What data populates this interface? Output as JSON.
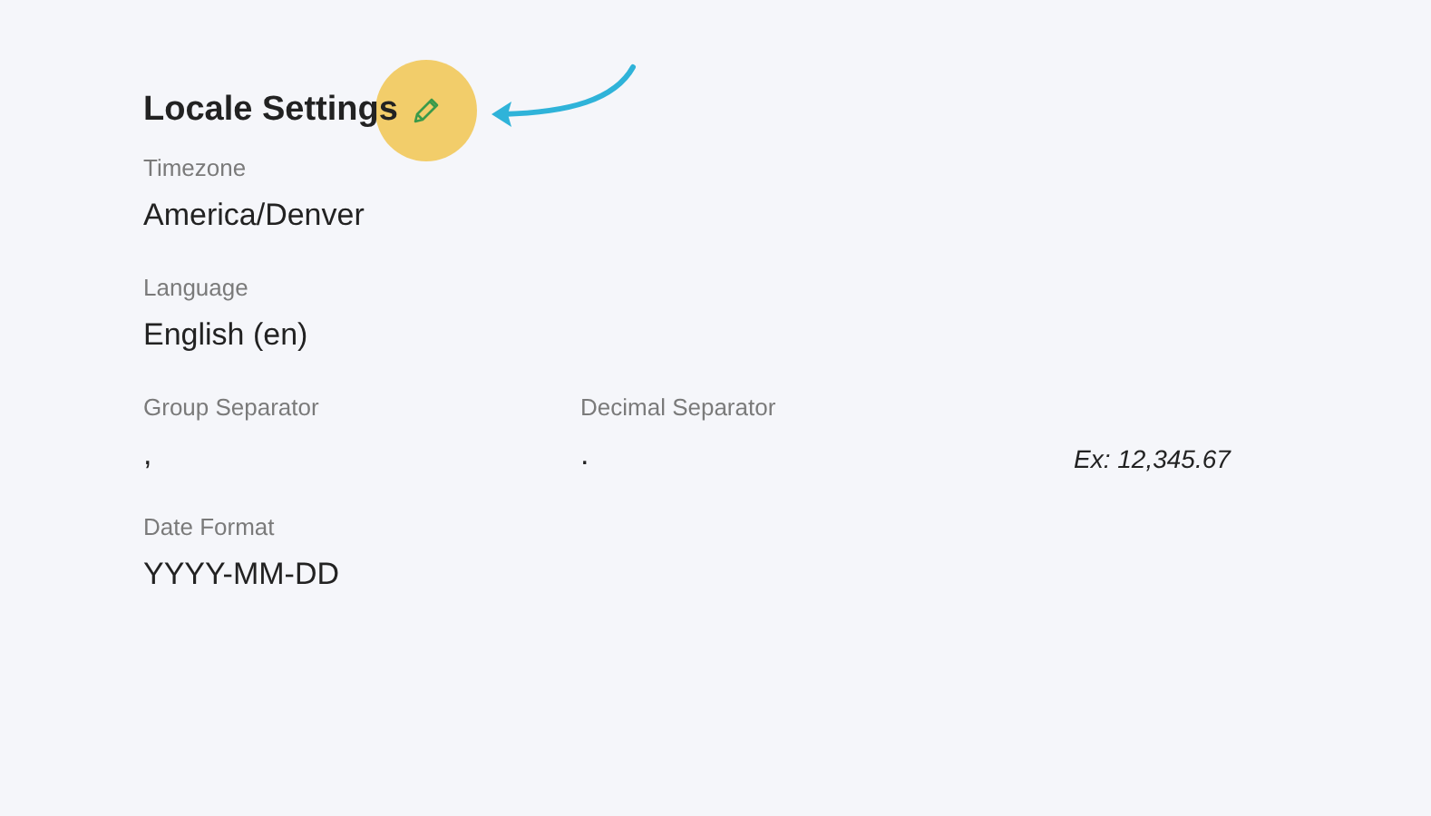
{
  "section": {
    "title": "Locale Settings"
  },
  "fields": [
    {
      "label": "Timezone",
      "value": "America/Denver"
    },
    {
      "label": "Language",
      "value": "English (en)"
    }
  ],
  "separators": {
    "group": {
      "label": "Group Separator",
      "value": ","
    },
    "decimal": {
      "label": "Decimal Separator",
      "value": "."
    },
    "example": "Ex: 12,345.67"
  },
  "date_format": {
    "label": "Date Format",
    "value": "YYYY-MM-DD"
  }
}
